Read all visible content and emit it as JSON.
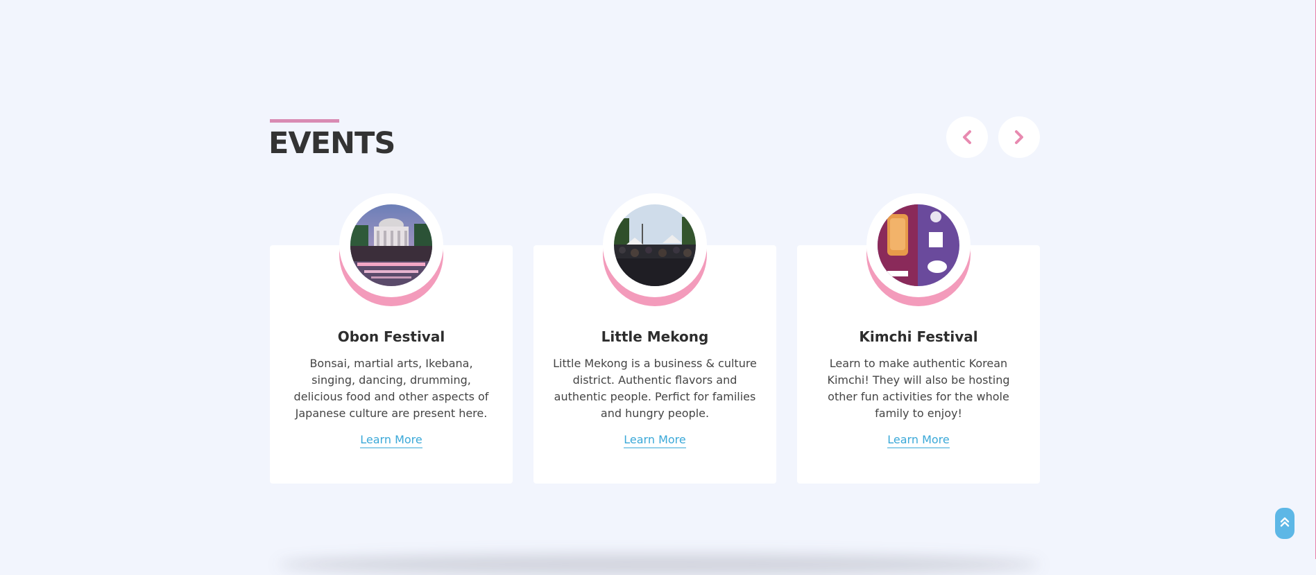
{
  "section": {
    "title": "EVENTS"
  },
  "carousel": {
    "prev_icon": "chevron-left-icon",
    "next_icon": "chevron-right-icon"
  },
  "events": [
    {
      "title": "Obon Festival",
      "description": "Bonsai, martial arts, Ikebana, singing, dancing, drumming, delicious food and other aspects of Japanese culture are present here.",
      "link_label": "Learn More"
    },
    {
      "title": "Little Mekong",
      "description": "Little Mekong is a business & culture district. Authentic flavors and authentic people. Perfict for families and hungry people.",
      "link_label": "Learn More"
    },
    {
      "title": "Kimchi Festival",
      "description": "Learn to make authentic Korean Kimchi! They will also be hosting other fun activities for the whole family to enjoy!",
      "link_label": "Learn More"
    }
  ],
  "scroll_top": {
    "icon": "double-chevron-up-icon"
  },
  "colors": {
    "background": "#f2f5fd",
    "accent_pink": "#f39bbb",
    "link_blue": "#3aa8d8",
    "heading": "#333333"
  }
}
